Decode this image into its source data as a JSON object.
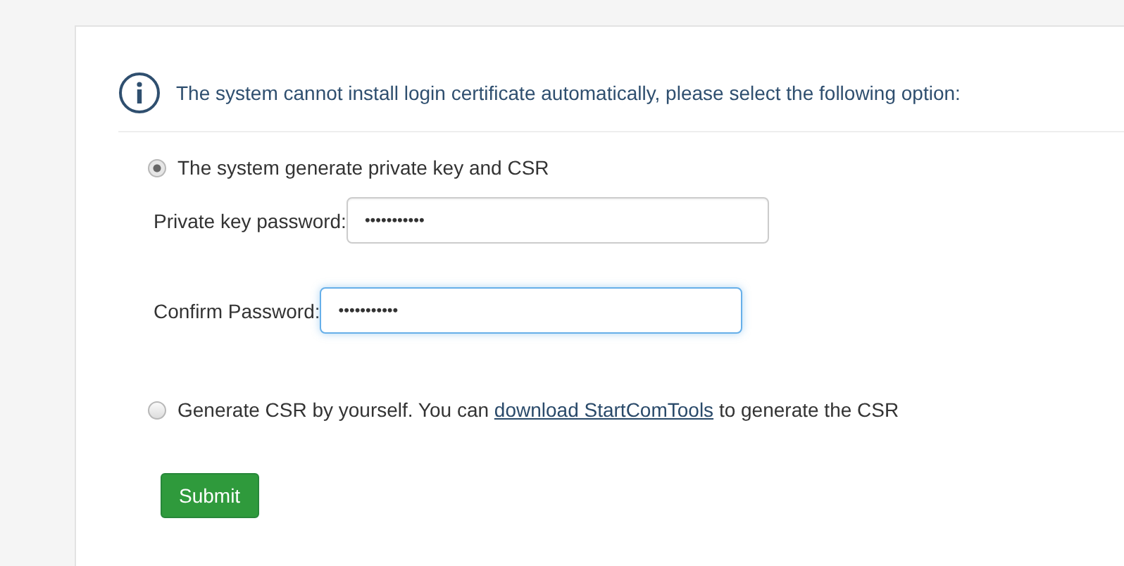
{
  "notice": {
    "text": "The system cannot install login certificate automatically, please select the following option:"
  },
  "options": [
    {
      "kind": "fields",
      "selected": true,
      "label": "The system generate private key and CSR",
      "fields": [
        {
          "label": "Private key password:",
          "value": "•••••••••••",
          "focused": false
        },
        {
          "label": "Confirm Password:",
          "value": "•••••••••••",
          "focused": true
        }
      ]
    },
    {
      "kind": "link",
      "selected": false,
      "text_before": "Generate CSR by yourself. You can ",
      "link": "download StartComTools",
      "text_after": " to generate the CSR"
    }
  ],
  "submit": "Submit"
}
